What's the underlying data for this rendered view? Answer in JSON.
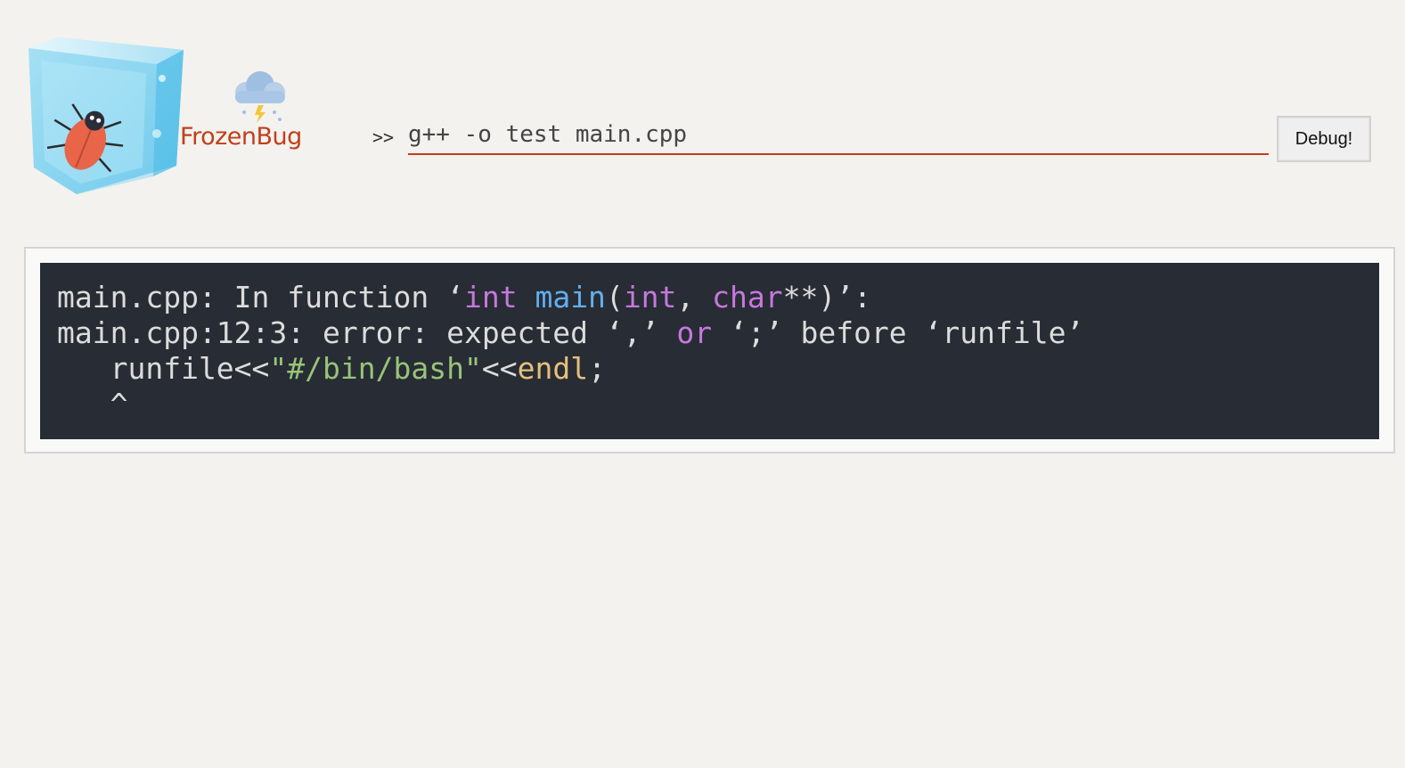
{
  "header": {
    "brand": "FrozenBug",
    "prompt": ">>",
    "command_value": "g++ -o test main.cpp",
    "debug_label": "Debug!"
  },
  "output": {
    "line1": {
      "t1": "main.cpp: In function ‘",
      "t2": "int",
      "t3": " ",
      "t4": "main",
      "t5": "(",
      "t6": "int",
      "t7": ", ",
      "t8": "char",
      "t9": "**)’:"
    },
    "line2": {
      "t1": "main.cpp:12:3: error: expected ‘,’ ",
      "t2": "or",
      "t3": " ‘;’ before ‘runfile’"
    },
    "line3": {
      "t1": "   runfile<<",
      "t2": "\"#/bin/bash\"",
      "t3": "<<",
      "t4": "endl",
      "t5": ";"
    },
    "line4": "   ^"
  },
  "colors": {
    "accent": "#c0401c",
    "code_bg": "#282c34",
    "keyword": "#c678dd",
    "function": "#61afef",
    "string": "#98c379",
    "identifier": "#e5c07b"
  },
  "icons": [
    "ice-cube-icon",
    "bug-icon",
    "storm-cloud-icon"
  ]
}
